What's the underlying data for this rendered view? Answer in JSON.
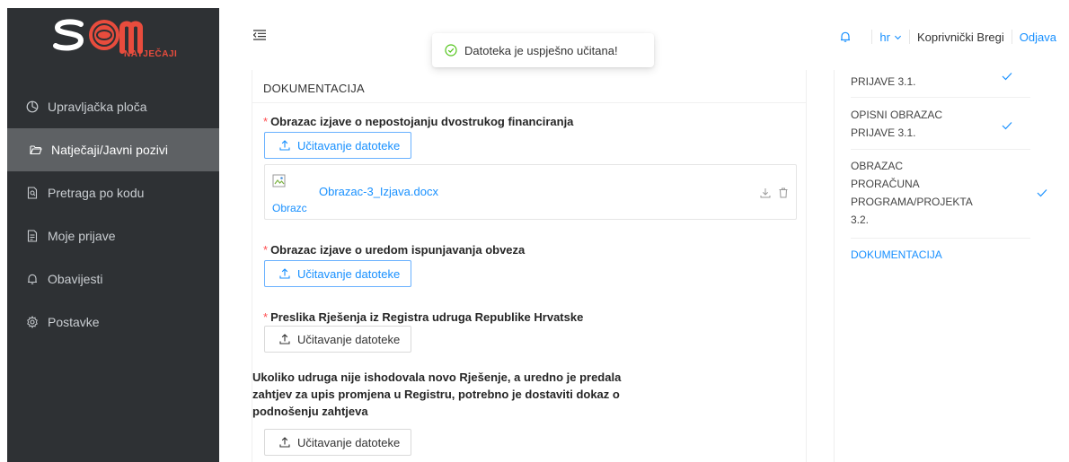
{
  "brand": {
    "logo_text": "SOM",
    "logo_subtext": "NATJEČAJI",
    "primary_color": "#e84c3d",
    "sidebar_bg": "#2e3134",
    "accent": "#1890ff"
  },
  "sidebar": {
    "items": [
      {
        "label": "Upravljačka ploča",
        "icon": "dashboard-icon"
      },
      {
        "label": "Natječaji/Javni pozivi",
        "icon": "folder-open-icon",
        "active": true
      },
      {
        "label": "Pretraga po kodu",
        "icon": "file-search-icon"
      },
      {
        "label": "Moje prijave",
        "icon": "file-text-icon"
      },
      {
        "label": "Obavijesti",
        "icon": "bell-icon"
      },
      {
        "label": "Postavke",
        "icon": "gear-icon"
      }
    ]
  },
  "header": {
    "toast": "Datoteka je uspješno učitana!",
    "language": "hr",
    "organization": "Koprivnički Bregi",
    "logout": "Odjava"
  },
  "main": {
    "section_title": "DOKUMENTACIJA",
    "fields": [
      {
        "label": "Obrazac izjave o nepostojanju dvostrukog financiranja",
        "required": true,
        "button": "Učitavanje datoteke"
      },
      {
        "label": "Obrazac izjave o uredom ispunjavanja obveza",
        "required": true,
        "button": "Učitavanje datoteke"
      },
      {
        "label": "Preslika Rješenja iz Registra udruga Republike Hrvatske",
        "required": true,
        "button": "Učitavanje datoteke"
      },
      {
        "label_lines": [
          "Ukoliko udruga nije ishodovala novo Rješenje, a uredno je predala",
          "zahtjev za upis promjena u Registru, potrebno je dostaviti dokaz o",
          "podnošenju zahtjeva"
        ],
        "required": false,
        "button": "Učitavanje datoteke"
      }
    ],
    "uploaded_file": {
      "name": "Obrazac-3_Izjava.docx",
      "thumb_alt": "Obrazc"
    }
  },
  "steps": [
    {
      "lines": [
        "PRIJAVE 3.1."
      ],
      "done": true
    },
    {
      "lines": [
        "OPISNI OBRAZAC",
        "PRIJAVE 3.1."
      ],
      "done": true
    },
    {
      "lines": [
        "OBRAZAC",
        "PRORAČUNA",
        "PROGRAMA/PROJEKTA",
        "3.2."
      ],
      "done": true
    },
    {
      "lines": [
        "DOKUMENTACIJA"
      ],
      "done": false,
      "active": true
    }
  ]
}
